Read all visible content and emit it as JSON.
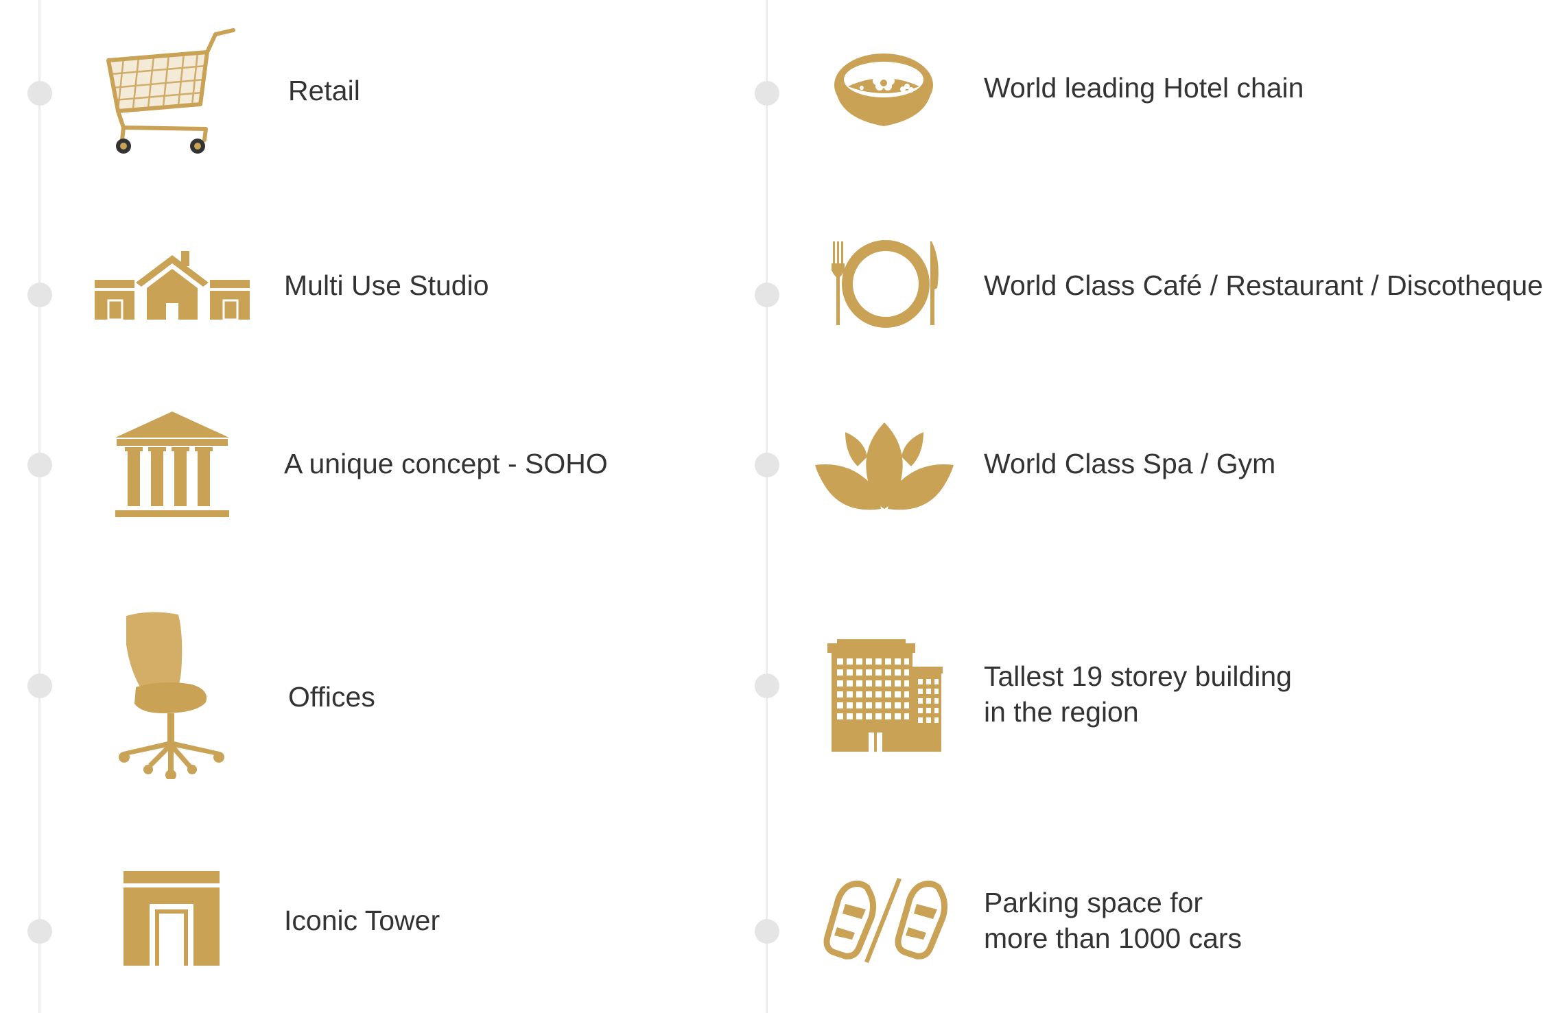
{
  "colors": {
    "gold": "#c9a256",
    "dot": "#e5e5e5",
    "line": "#ededed",
    "text": "#333333"
  },
  "left_column": [
    {
      "icon": "shopping-cart-icon",
      "label": "Retail"
    },
    {
      "icon": "studio-houses-icon",
      "label": "Multi Use Studio"
    },
    {
      "icon": "classical-building-icon",
      "label": "A unique concept - SOHO"
    },
    {
      "icon": "office-chair-icon",
      "label": "Offices"
    },
    {
      "icon": "tower-door-icon",
      "label": "Iconic Tower"
    }
  ],
  "right_column": [
    {
      "icon": "spa-bowl-icon",
      "label": "World leading Hotel chain"
    },
    {
      "icon": "plate-cutlery-icon",
      "label": "World Class Café / Restaurant / Discotheque"
    },
    {
      "icon": "lotus-icon",
      "label": "World Class Spa / Gym"
    },
    {
      "icon": "high-rise-building-icon",
      "lines": [
        "Tallest 19 storey building",
        "in the region"
      ]
    },
    {
      "icon": "parking-cars-icon",
      "lines": [
        "Parking space for",
        "more than 1000 cars"
      ]
    }
  ]
}
